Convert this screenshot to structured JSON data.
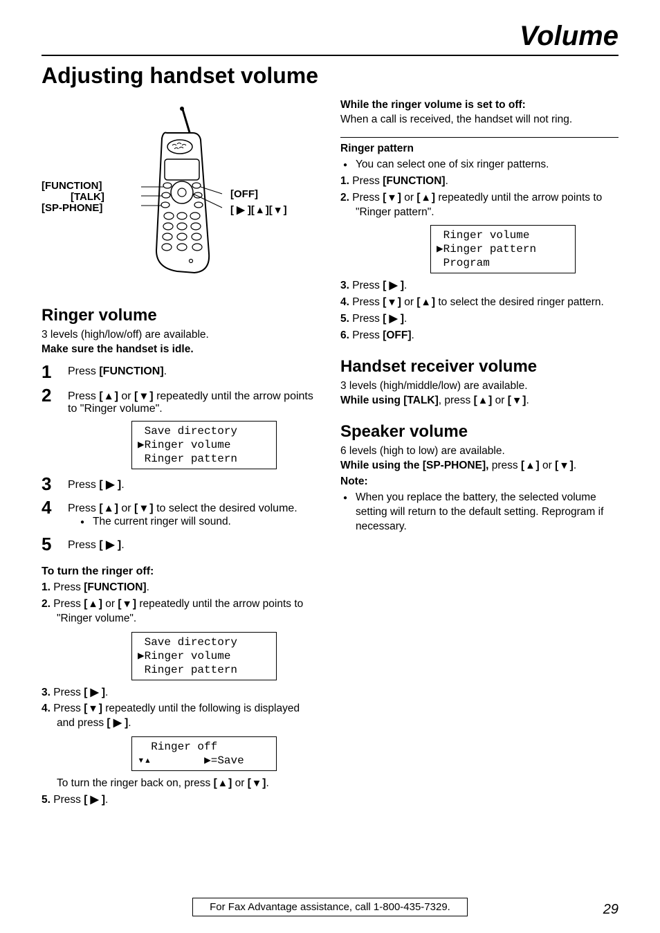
{
  "page_title": "Volume",
  "section_title": "Adjusting handset volume",
  "diagram": {
    "labels": {
      "function": "[FUNCTION]",
      "talk": "[TALK]",
      "sp_phone": "[SP-PHONE]",
      "off": "[OFF]",
      "arrows": "[ ▶ ][ ▴ ][ ▾ ]"
    }
  },
  "left": {
    "h2": "Ringer volume",
    "intro1": "3 levels (high/low/off) are available.",
    "intro2": "Make sure the handset is idle.",
    "step1": {
      "n": "1",
      "pre": "Press ",
      "key": "[FUNCTION]",
      "post": "."
    },
    "step2": {
      "n": "2",
      "pre": "Press ",
      "k1": "[ ▴ ]",
      "mid": " or ",
      "k2": "[ ▾ ]",
      "post": " repeatedly until the arrow points to \"Ringer volume\"."
    },
    "lcd1": " Save directory\n▶Ringer volume\n Ringer pattern",
    "step3": {
      "n": "3",
      "pre": "Press ",
      "key": "[ ▶ ]",
      "post": "."
    },
    "step4": {
      "n": "4",
      "pre": "Press ",
      "k1": "[ ▴ ]",
      "mid": " or ",
      "k2": "[ ▾ ]",
      "post": " to select the desired volume.",
      "bullet": "The current ringer will sound."
    },
    "step5": {
      "n": "5",
      "pre": "Press ",
      "key": "[ ▶ ]",
      "post": "."
    },
    "off_h": "To turn the ringer off:",
    "off1": {
      "n": "1.",
      "pre": "Press ",
      "key": "[FUNCTION]",
      "post": "."
    },
    "off2": {
      "n": "2.",
      "pre": "Press ",
      "k1": "[ ▴ ]",
      "mid": " or ",
      "k2": "[ ▾ ]",
      "post": " repeatedly until the arrow points to \"Ringer volume\"."
    },
    "lcd2": " Save directory\n▶Ringer volume\n Ringer pattern",
    "off3": {
      "n": "3.",
      "pre": "Press ",
      "key": "[ ▶ ]",
      "post": "."
    },
    "off4": {
      "n": "4.",
      "pre": "Press ",
      "k1": "[ ▾ ]",
      "post1": " repeatedly until the following is displayed and press ",
      "k2": "[ ▶ ]",
      "post2": "."
    },
    "lcd3": "  Ringer off\n▾▴        ▶=Save",
    "off_back": {
      "pre": "To turn the ringer back on, press ",
      "k1": "[ ▴ ]",
      "mid": " or ",
      "k2": "[ ▾ ]",
      "post": "."
    },
    "off5": {
      "n": "5.",
      "pre": "Press ",
      "key": "[ ▶ ]",
      "post": "."
    }
  },
  "right": {
    "while_off_h": "While the ringer volume is set to off:",
    "while_off_p": "When a call is received, the handset will not ring.",
    "pattern_h": "Ringer pattern",
    "pattern_bullet": "You can select one of six ringer patterns.",
    "p1": {
      "n": "1.",
      "pre": "Press ",
      "key": "[FUNCTION]",
      "post": "."
    },
    "p2": {
      "n": "2.",
      "pre": "Press ",
      "k1": "[ ▾ ]",
      "mid": " or ",
      "k2": "[ ▴ ]",
      "post": " repeatedly until the arrow points to \"Ringer pattern\"."
    },
    "lcd": " Ringer volume\n▶Ringer pattern\n Program",
    "p3": {
      "n": "3.",
      "pre": "Press ",
      "key": "[ ▶ ]",
      "post": "."
    },
    "p4": {
      "n": "4.",
      "pre": "Press ",
      "k1": "[ ▾ ]",
      "mid": " or ",
      "k2": "[ ▴ ]",
      "post": " to select the desired ringer pattern."
    },
    "p5": {
      "n": "5.",
      "pre": "Press ",
      "key": "[ ▶ ]",
      "post": "."
    },
    "p6": {
      "n": "6.",
      "pre": "Press ",
      "key": "[OFF]",
      "post": "."
    },
    "recv_h": "Handset receiver volume",
    "recv_p1": "3 levels (high/middle/low) are available.",
    "recv_p2a": "While using ",
    "recv_p2_key": "[TALK]",
    "recv_p2b": ", press ",
    "recv_p2_k1": "[ ▴ ]",
    "recv_p2_mid": " or ",
    "recv_p2_k2": "[ ▾ ]",
    "recv_p2c": ".",
    "spk_h": "Speaker volume",
    "spk_p1": "6 levels (high to low) are available.",
    "spk_p2a": "While using the ",
    "spk_p2_key": "[SP-PHONE]",
    "spk_p2b": ", ",
    "spk_p2_press": "press ",
    "spk_p2_k1": "[ ▴ ]",
    "spk_p2_mid": " or ",
    "spk_p2_k2": "[ ▾ ]",
    "spk_p2c": ".",
    "note_h": "Note:",
    "note_bullet": "When you replace the battery, the selected volume setting will return to the default setting. Reprogram if necessary."
  },
  "footer": "For Fax Advantage assistance, call 1-800-435-7329.",
  "page_num": "29"
}
